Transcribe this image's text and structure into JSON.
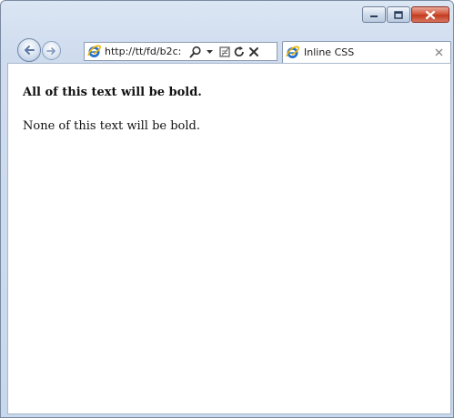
{
  "browser": {
    "address": {
      "url": "http://tt/fd/b2c:"
    },
    "tab": {
      "title": "Inline CSS"
    }
  },
  "page": {
    "bold_paragraph": "All of this text will be bold.",
    "normal_paragraph": "None of this text will be bold."
  },
  "icons": {
    "minimize": "minimize-icon",
    "maximize": "maximize-icon",
    "close": "close-icon",
    "back": "back-arrow-icon",
    "forward": "forward-arrow-icon",
    "site_logo": "ie-logo-icon",
    "search": "search-icon",
    "dropdown": "dropdown-icon",
    "compat": "compatibility-view-icon",
    "refresh": "refresh-icon",
    "stop": "stop-icon",
    "tab_close": "tab-close-icon"
  },
  "colors": {
    "frame": "#cfdcee",
    "close_button": "#c8442a",
    "ie_blue": "#1f6fd0",
    "ie_gold": "#f0b400"
  }
}
